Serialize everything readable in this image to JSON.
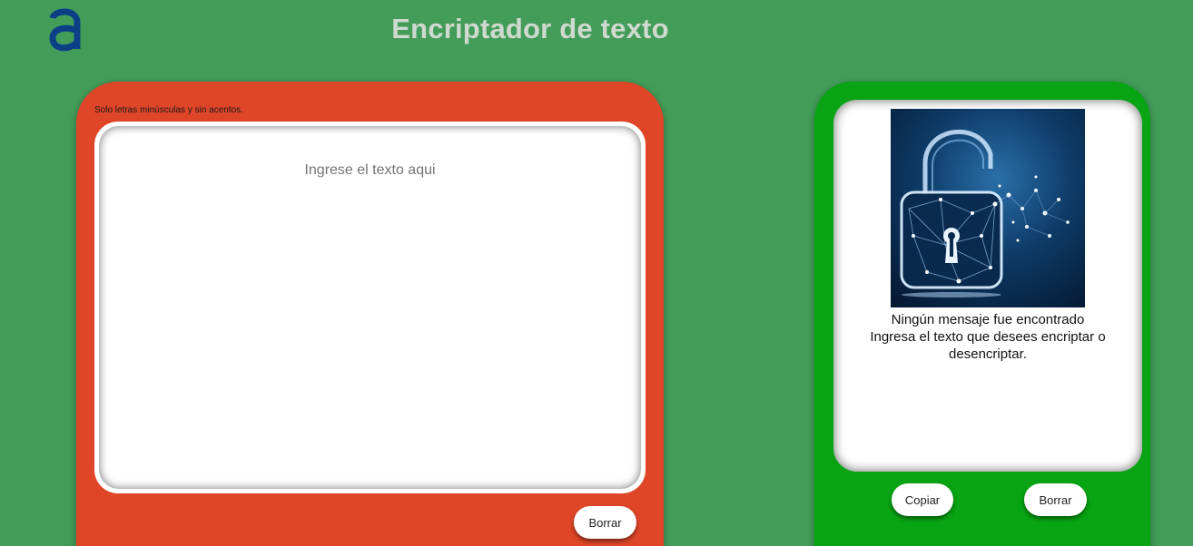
{
  "header": {
    "title": "Encriptador de texto",
    "logo_letter": "a",
    "logo_color": "#0b3f86"
  },
  "input_panel": {
    "hint": "Solo letras minúsculas y sin acentos.",
    "placeholder": "Ingrese el texto aqui",
    "value": "",
    "clear_label": "Borrar",
    "background": "#df4628"
  },
  "output_panel": {
    "image_icon": "padlock-network-icon",
    "empty_title": "Ningún mensaje fue encontrado",
    "empty_body": "Ingresa el texto que desees encriptar o desencriptar.",
    "copy_label": "Copiar",
    "clear_label": "Borrar",
    "background": "#08a413"
  },
  "colors": {
    "page_background": "#439d59",
    "title_color": "#cfd9d0"
  }
}
